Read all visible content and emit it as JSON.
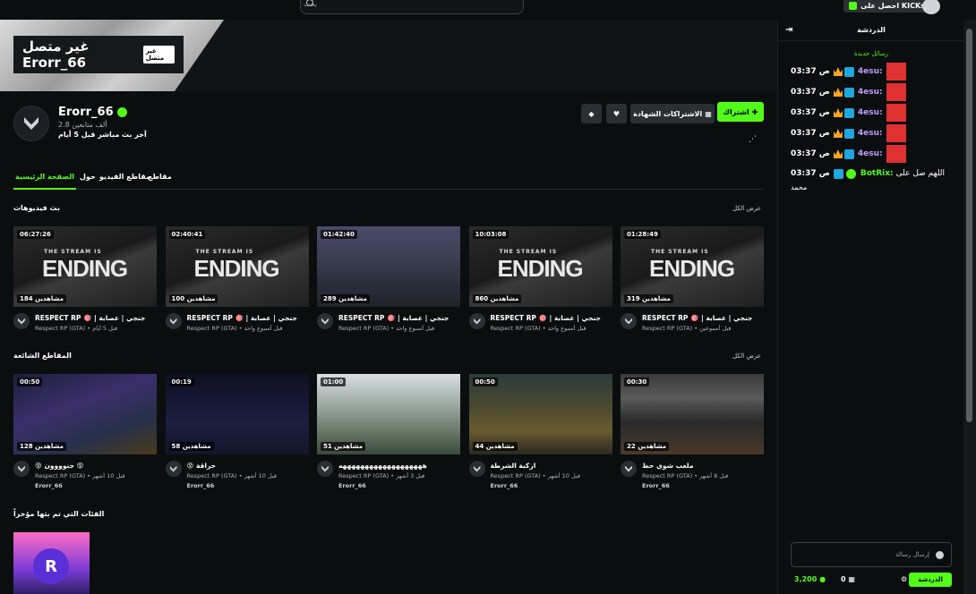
{
  "topbar": {
    "search_placeholder": "بحث",
    "kicks_label": "احصل على KICKs"
  },
  "banner": {
    "offline_title": "غير متصل Erorr_66",
    "offline_tag": "غير متصل"
  },
  "channel": {
    "name": "Erorr_66",
    "followers": "2.8 ألف متابعين",
    "last_stream": "آخر بث مباشر قبل 5 أيام",
    "follow_label": "اشتراك",
    "subscribe_label": "الاشتراكات الشهادة"
  },
  "tabs": [
    {
      "label": "الصفحة الرئيسية"
    },
    {
      "label": "حول"
    },
    {
      "label": "مقاطع الفيديو"
    },
    {
      "label": "مقاطع"
    }
  ],
  "sections": {
    "videos_title": "بث فيديوهات",
    "clips_title": "المقاطع الشائعة",
    "recent_title": "الفئات التي تم بثها مؤخراً",
    "see_all": "عرض الكل"
  },
  "videos": [
    {
      "duration": "06:27:26",
      "views": "184 مشاهدين",
      "title": "RESPECT RP 🎯 | جنجي | عصابة",
      "sub": "Respect RP (GTA) • قبل 5 أيام",
      "thumb": "end"
    },
    {
      "duration": "02:40:41",
      "views": "100 مشاهدين",
      "title": "RESPECT RP 🎯 | جنجي | عصابة",
      "sub": "Respect RP (GTA) • قبل أسبوع واحد",
      "thumb": "end"
    },
    {
      "duration": "01:42:40",
      "views": "289 مشاهدين",
      "title": "RESPECT RP 🎯 | جنجي | عصابة",
      "sub": "Respect RP (GTA) • قبل أسبوع واحد",
      "thumb": "gta"
    },
    {
      "duration": "10:03:08",
      "views": "860 مشاهدين",
      "title": "RESPECT RP 🎯 | جنجي | عصابة",
      "sub": "Respect RP (GTA) • قبل أسبوع واحد",
      "thumb": "end"
    },
    {
      "duration": "01:28:49",
      "views": "319 مشاهدين",
      "title": "RESPECT RP 🎯 | جنجي | عصابة",
      "sub": "Respect RP (GTA) • قبل أسبوعين",
      "thumb": "end"
    }
  ],
  "clips": [
    {
      "duration": "00:50",
      "views": "128 مشاهدين",
      "title": "😵 جنوووون 😵",
      "sub": "Respect RP (GTA) • قبل 10 أشهر",
      "author": "Erorr_66",
      "thumb": "g1"
    },
    {
      "duration": "00:19",
      "views": "58 مشاهدين",
      "title": "😵 حراقة",
      "sub": "Respect RP (GTA) • قبل 10 أشهر",
      "author": "Erorr_66",
      "thumb": "g2"
    },
    {
      "duration": "01:00",
      "views": "51 مشاهدين",
      "title": "هههههههههههههههههههه",
      "sub": "Respect RP (GTA) • قبل 3 أشهر",
      "author": "Erorr_66",
      "thumb": "g3"
    },
    {
      "duration": "00:50",
      "views": "44 مشاهدين",
      "title": "اركبة الشرطة",
      "sub": "Respect RP (GTA) • قبل 10 أشهر",
      "author": "Erorr_66",
      "thumb": "g4"
    },
    {
      "duration": "00:30",
      "views": "22 مشاهدين",
      "title": "ملعب شوي حظ",
      "sub": "Respect RP (GTA) • قبل 8 أشهر",
      "author": "Erorr_66",
      "thumb": "g5"
    }
  ],
  "thumb_texts": {
    "ending_small": "THE STREAM IS",
    "ending_big": "ENDING"
  },
  "chat": {
    "title": "الدردشة",
    "new_messages": "رسائل جديدة",
    "messages": [
      {
        "time": "03:37 ص",
        "user": "4esu:",
        "text": ""
      },
      {
        "time": "03:37 ص",
        "user": "4esu:",
        "text": ""
      },
      {
        "time": "03:37 ص",
        "user": "4esu:",
        "text": ""
      },
      {
        "time": "03:37 ص",
        "user": "4esu:",
        "text": ""
      },
      {
        "time": "03:37 ص",
        "user": "4esu:",
        "text": ""
      }
    ],
    "bot_message": {
      "time": "03:37 ص",
      "user": "BotRix:",
      "text": "اللهم صل على",
      "text2": "محمد"
    },
    "input_placeholder": "إرسال رسالة",
    "send_label": "الدردشة",
    "points": "3,200",
    "subs_count": "0"
  },
  "colors": {
    "accent": "#53fc18",
    "bg": "#0b0e0f"
  }
}
